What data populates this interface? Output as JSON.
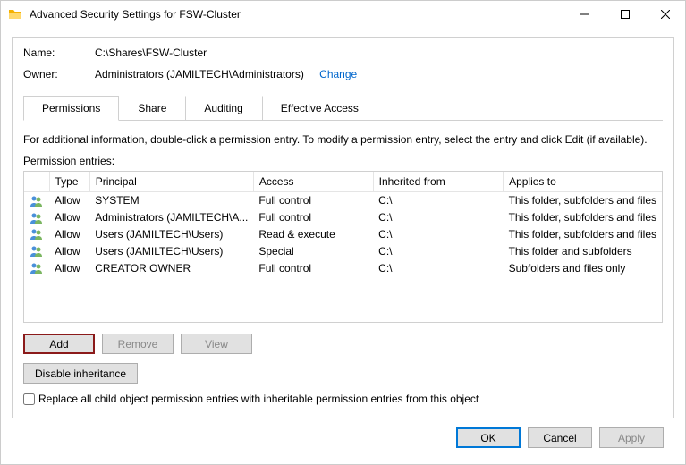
{
  "window": {
    "title": "Advanced Security Settings for FSW-Cluster"
  },
  "info": {
    "name_label": "Name:",
    "name_value": "C:\\Shares\\FSW-Cluster",
    "owner_label": "Owner:",
    "owner_value": "Administrators (JAMILTECH\\Administrators)",
    "change_label": "Change"
  },
  "tabs": {
    "permissions": "Permissions",
    "share": "Share",
    "auditing": "Auditing",
    "effective": "Effective Access"
  },
  "hint": "For additional information, double-click a permission entry. To modify a permission entry, select the entry and click Edit (if available).",
  "section_label": "Permission entries:",
  "columns": {
    "type": "Type",
    "principal": "Principal",
    "access": "Access",
    "inherited": "Inherited from",
    "applies": "Applies to"
  },
  "entries": [
    {
      "type": "Allow",
      "principal": "SYSTEM",
      "access": "Full control",
      "inherited": "C:\\",
      "applies": "This folder, subfolders and files"
    },
    {
      "type": "Allow",
      "principal": "Administrators (JAMILTECH\\A...",
      "access": "Full control",
      "inherited": "C:\\",
      "applies": "This folder, subfolders and files"
    },
    {
      "type": "Allow",
      "principal": "Users (JAMILTECH\\Users)",
      "access": "Read & execute",
      "inherited": "C:\\",
      "applies": "This folder, subfolders and files"
    },
    {
      "type": "Allow",
      "principal": "Users (JAMILTECH\\Users)",
      "access": "Special",
      "inherited": "C:\\",
      "applies": "This folder and subfolders"
    },
    {
      "type": "Allow",
      "principal": "CREATOR OWNER",
      "access": "Full control",
      "inherited": "C:\\",
      "applies": "Subfolders and files only"
    }
  ],
  "buttons": {
    "add": "Add",
    "remove": "Remove",
    "view": "View",
    "disable_inh": "Disable inheritance",
    "replace_label": "Replace all child object permission entries with inheritable permission entries from this object",
    "ok": "OK",
    "cancel": "Cancel",
    "apply": "Apply"
  }
}
